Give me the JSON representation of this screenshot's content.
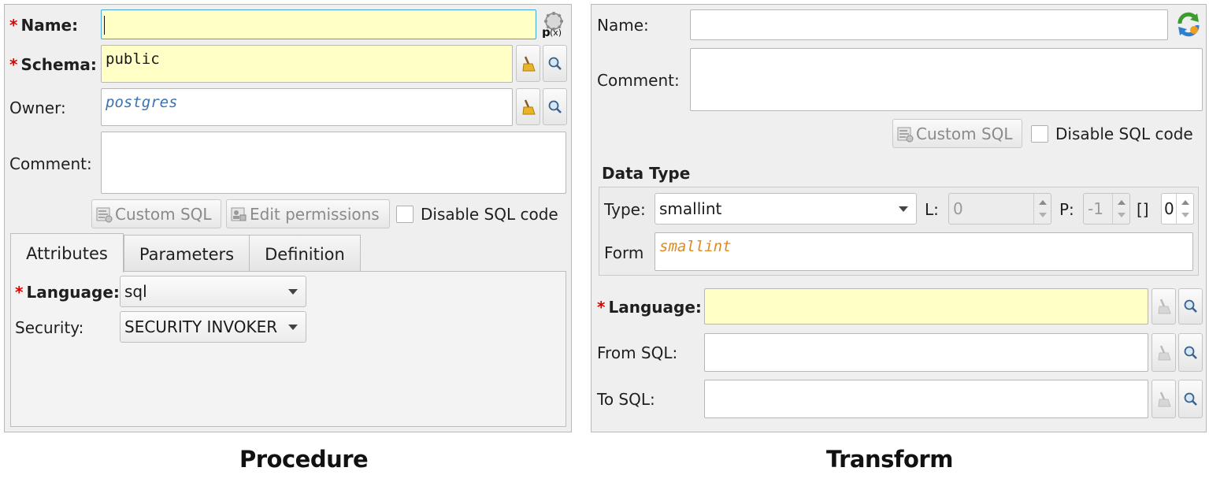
{
  "procedure": {
    "caption": "Procedure",
    "name_label": "Name:",
    "name_value": "",
    "schema_label": "Schema:",
    "schema_value": "public",
    "owner_label": "Owner:",
    "owner_value": "postgres",
    "comment_label": "Comment:",
    "comment_value": "",
    "custom_sql_label": "Custom SQL",
    "edit_permissions_label": "Edit permissions",
    "disable_sql_label": "Disable SQL code",
    "tabs": [
      {
        "label": "Attributes",
        "active": true
      },
      {
        "label": "Parameters",
        "active": false
      },
      {
        "label": "Definition",
        "active": false
      }
    ],
    "language_label": "Language:",
    "language_value": "sql",
    "security_label": "Security:",
    "security_value": "SECURITY INVOKER"
  },
  "transform": {
    "caption": "Transform",
    "name_label": "Name:",
    "name_value": "",
    "comment_label": "Comment:",
    "comment_value": "",
    "custom_sql_label": "Custom SQL",
    "disable_sql_label": "Disable SQL code",
    "data_type_title": "Data Type",
    "type_label": "Type:",
    "type_value": "smallint",
    "l_label": "L:",
    "l_value": "0",
    "p_label": "P:",
    "p_value": "-1",
    "dim_label": "[]",
    "dim_value": "0",
    "format_label": "Form",
    "format_value": "smallint",
    "language_label": "Language:",
    "language_value": "",
    "from_sql_label": "From SQL:",
    "from_sql_value": "",
    "to_sql_label": "To SQL:",
    "to_sql_value": ""
  },
  "colors": {
    "required": "#e00000",
    "required_field_bg": "#ffffc6",
    "owner_text": "#3d74b0",
    "format_text": "#e08a1e",
    "focus_border": "#46a7d9"
  },
  "icons": {
    "parameter_generator": "gear-pfx-icon",
    "clear": "broom-icon",
    "select": "magnifier-icon",
    "custom_sql": "sql-code-icon",
    "edit_permissions": "permissions-icon",
    "sync": "sync-arrows-icon"
  }
}
